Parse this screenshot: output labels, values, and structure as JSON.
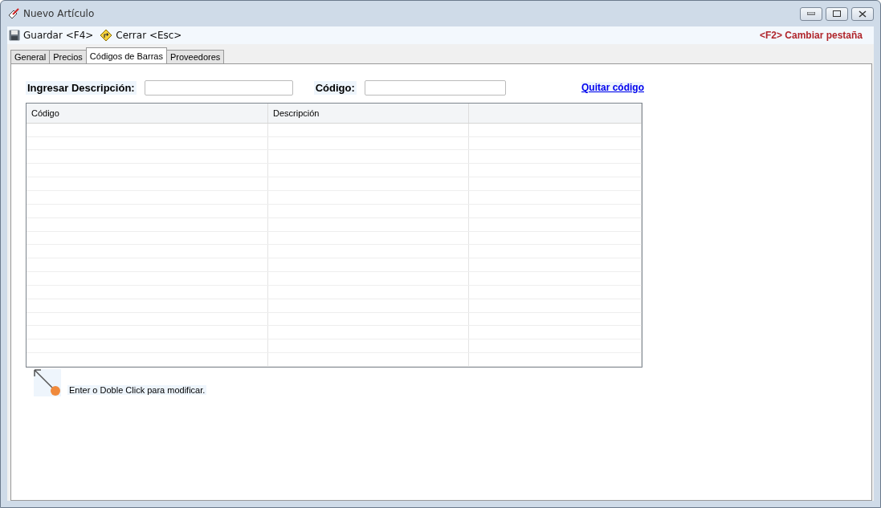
{
  "window": {
    "title": "Nuevo Artículo"
  },
  "toolbar": {
    "buttons": [
      {
        "kind": "save",
        "label": "Guardar <F4>"
      },
      {
        "kind": "close",
        "label": "Cerrar <Esc>"
      }
    ],
    "hint": "<F2> Cambiar pestaña"
  },
  "tabs": [
    {
      "label": "General",
      "selected": false
    },
    {
      "label": "Precios",
      "selected": false
    },
    {
      "label": "Códigos de Barras",
      "selected": true
    },
    {
      "label": "Proveedores",
      "selected": false
    }
  ],
  "form": {
    "description_label": "Ingresar Descripción:",
    "code_label": "Código:",
    "remove_link": "Quitar código"
  },
  "table": {
    "columns": [
      "Código",
      "Descripción",
      ""
    ]
  },
  "footer_hint": "Enter o Doble Click para modificar."
}
